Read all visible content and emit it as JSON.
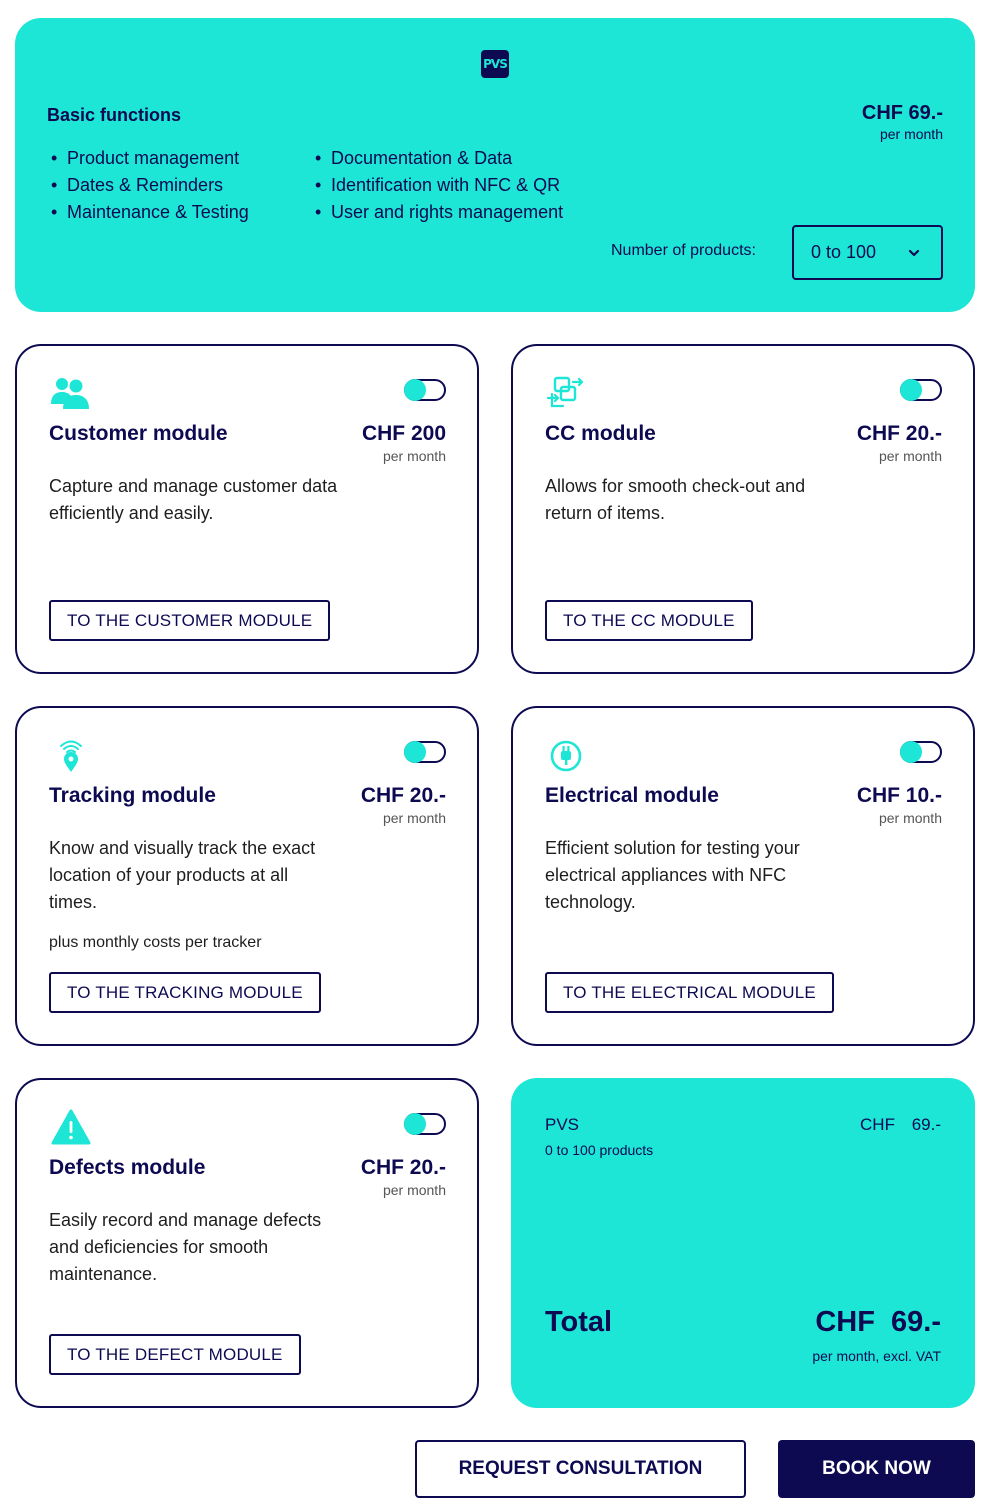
{
  "basic": {
    "logo_text": "PVS",
    "title": "Basic functions",
    "features_left": [
      "Product management",
      "Dates & Reminders",
      "Maintenance & Testing"
    ],
    "features_right": [
      "Documentation & Data",
      "Identification with NFC & QR",
      "User and rights management"
    ],
    "price": "CHF 69.-",
    "price_period": "per month",
    "products_label": "Number of products:",
    "products_selected": "0 to 100"
  },
  "modules": [
    {
      "icon": "users-icon",
      "title": "Customer module",
      "price": "CHF 200",
      "period": "per month",
      "description": "Capture and manage customer data efficiently and easily.",
      "note": "",
      "button": "TO THE CUSTOMER MODULE",
      "enabled": false
    },
    {
      "icon": "exchange-icon",
      "title": "CC module",
      "price": "CHF 20.-",
      "period": "per month",
      "description": "Allows for smooth check-out and return of items.",
      "note": "",
      "button": "TO THE CC MODULE",
      "enabled": false
    },
    {
      "icon": "location-signal-icon",
      "title": "Tracking module",
      "price": "CHF 20.-",
      "period": "per month",
      "description": "Know and visually track the exact location of your products at all times.",
      "note": "plus monthly costs per tracker",
      "button": "TO THE TRACKING MODULE",
      "enabled": false
    },
    {
      "icon": "plug-icon",
      "title": "Electrical module",
      "price": "CHF 10.-",
      "period": "per month",
      "description": "Efficient solution for testing your electrical appliances with NFC technology.",
      "note": "",
      "button": "TO THE ELECTRICAL MODULE",
      "enabled": false
    },
    {
      "icon": "warning-icon",
      "title": "Defects module",
      "price": "CHF 20.-",
      "period": "per month",
      "description": "Easily record and manage defects and deficiencies for smooth maintenance.",
      "note": "",
      "button": "TO THE DEFECT MODULE",
      "enabled": false
    }
  ],
  "summary": {
    "name": "PVS",
    "products": "0 to 100 products",
    "price": "CHF 69.-",
    "total_label": "Total",
    "total_amount": "CHF 69.-",
    "total_note": "per month, excl. VAT"
  },
  "actions": {
    "consult": "REQUEST CONSULTATION",
    "book": "BOOK NOW"
  },
  "colors": {
    "accent": "#1de6d6",
    "navy": "#0d0a52"
  }
}
